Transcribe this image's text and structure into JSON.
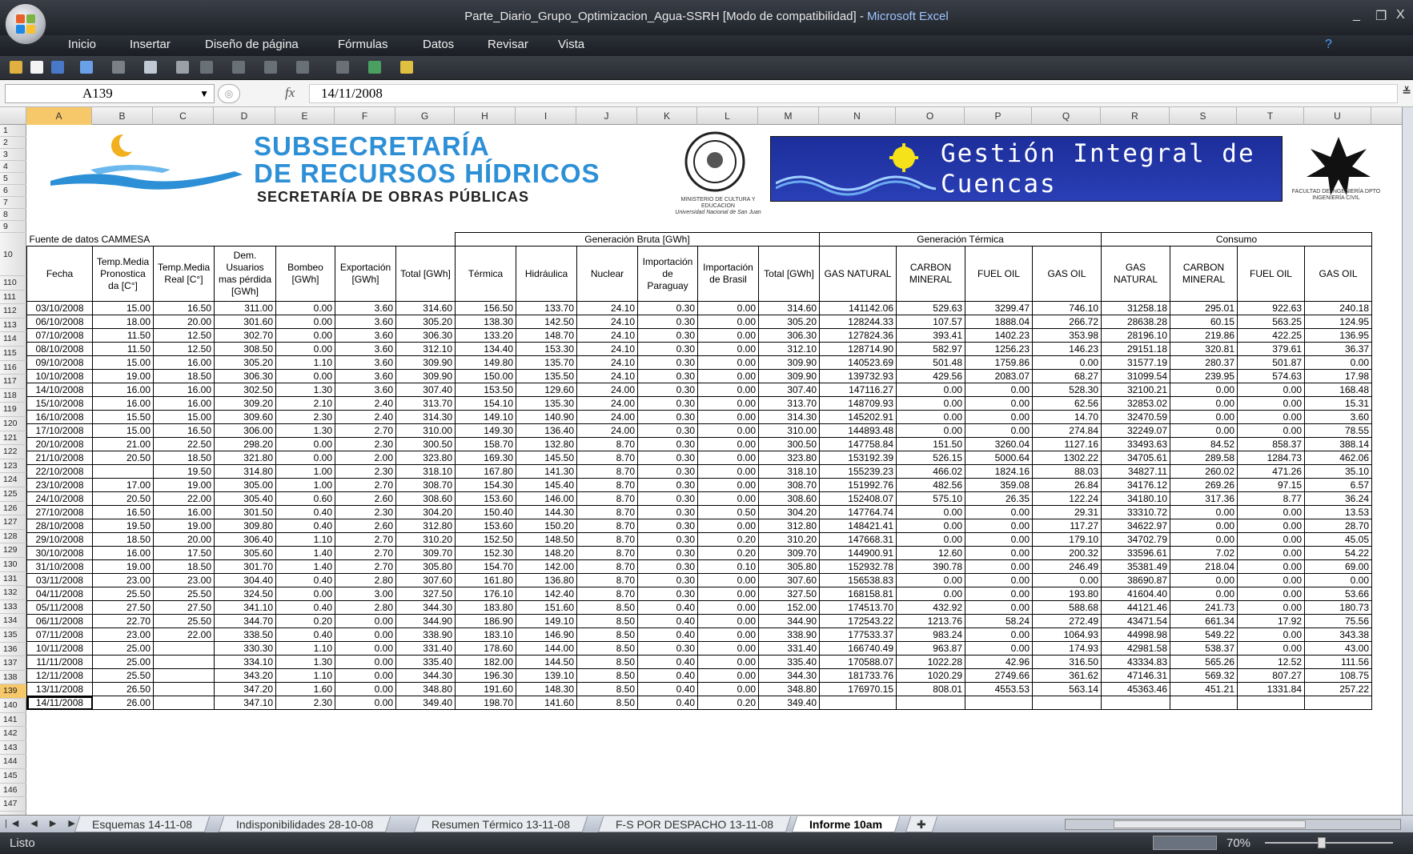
{
  "window": {
    "title": "Parte_Diario_Grupo_Optimizacion_Agua-SSRH  [Modo de compatibilidad]",
    "app": "Microsoft Excel",
    "controls": [
      "_",
      "❐",
      "X"
    ]
  },
  "ribbon": {
    "tabs": [
      "Inicio",
      "Insertar",
      "Diseño de página",
      "Fórmulas",
      "Datos",
      "Revisar",
      "Vista"
    ]
  },
  "formula_bar": {
    "name_box": "A139",
    "fx": "fx",
    "value": "14/11/2008"
  },
  "columns": [
    "A",
    "B",
    "C",
    "D",
    "E",
    "F",
    "G",
    "H",
    "I",
    "J",
    "K",
    "L",
    "M",
    "N",
    "O",
    "P",
    "Q",
    "R",
    "S",
    "T",
    "U"
  ],
  "row_headers": [
    "1",
    "2",
    "3",
    "4",
    "5",
    "6",
    "7",
    "8",
    "9",
    "10",
    "110",
    "111",
    "112",
    "113",
    "114",
    "115",
    "116",
    "117",
    "118",
    "119",
    "120",
    "121",
    "122",
    "123",
    "124",
    "125",
    "126",
    "127",
    "128",
    "129",
    "130",
    "131",
    "132",
    "133",
    "134",
    "135",
    "136",
    "137",
    "138",
    "139",
    "140",
    "141",
    "142",
    "143",
    "144",
    "145",
    "146",
    "147",
    "148"
  ],
  "banner": {
    "subsec_1": "SUBSECRETARÍA",
    "subsec_2": "DE RECURSOS HÍDRICOS",
    "secretaria": "SECRETARÍA DE OBRAS PÚBLICAS",
    "ministerio": "MINISTERIO DE CULTURA Y EDUCACION",
    "universidad": "Universidad Nacional de San Juan",
    "gih_1": "Gestión Integral de",
    "gih_2": "Cuencas Hidrográficas",
    "facultad": "FACULTAD DE INGENIERÍA DPTO INGENIERÍA CIVIL"
  },
  "table": {
    "source": "Fuente de datos CAMMESA",
    "groups": {
      "gen_bruta": "Generación Bruta [GWh]",
      "gen_termica": "Generación Térmica",
      "consumo": "Consumo"
    },
    "headers": [
      "Fecha",
      "Temp.Media Pronostica da [C°]",
      "Temp.Media Real [C°]",
      "Dem. Usuarios mas pérdida [GWh]",
      "Bombeo [GWh]",
      "Exportación [GWh]",
      "Total [GWh]",
      "Térmica",
      "Hidráulica",
      "Nuclear",
      "Importación de Paraguay",
      "Importación de Brasil",
      "Total [GWh]",
      "GAS NATURAL",
      "CARBON MINERAL",
      "FUEL OIL",
      "GAS OIL",
      "GAS NATURAL",
      "CARBON MINERAL",
      "FUEL OIL",
      "GAS OIL"
    ],
    "rows": [
      [
        "03/10/2008",
        "15.00",
        "16.50",
        "311.00",
        "0.00",
        "3.60",
        "314.60",
        "156.50",
        "133.70",
        "24.10",
        "0.30",
        "0.00",
        "314.60",
        "141142.06",
        "529.63",
        "3299.47",
        "746.10",
        "31258.18",
        "295.01",
        "922.63",
        "240.18"
      ],
      [
        "06/10/2008",
        "18.00",
        "20.00",
        "301.60",
        "0.00",
        "3.60",
        "305.20",
        "138.30",
        "142.50",
        "24.10",
        "0.30",
        "0.00",
        "305.20",
        "128244.33",
        "107.57",
        "1888.04",
        "266.72",
        "28638.28",
        "60.15",
        "563.25",
        "124.95"
      ],
      [
        "07/10/2008",
        "11.50",
        "12.50",
        "302.70",
        "0.00",
        "3.60",
        "306.30",
        "133.20",
        "148.70",
        "24.10",
        "0.30",
        "0.00",
        "306.30",
        "127824.36",
        "393.41",
        "1402.23",
        "353.98",
        "28196.10",
        "219.86",
        "422.25",
        "136.95"
      ],
      [
        "08/10/2008",
        "11.50",
        "12.50",
        "308.50",
        "0.00",
        "3.60",
        "312.10",
        "134.40",
        "153.30",
        "24.10",
        "0.30",
        "0.00",
        "312.10",
        "128714.90",
        "582.97",
        "1256.23",
        "146.23",
        "29151.18",
        "320.81",
        "379.61",
        "36.37"
      ],
      [
        "09/10/2008",
        "15.00",
        "16.00",
        "305.20",
        "1.10",
        "3.60",
        "309.90",
        "149.80",
        "135.70",
        "24.10",
        "0.30",
        "0.00",
        "309.90",
        "140523.69",
        "501.48",
        "1759.86",
        "0.00",
        "31577.19",
        "280.37",
        "501.87",
        "0.00"
      ],
      [
        "10/10/2008",
        "19.00",
        "18.50",
        "306.30",
        "0.00",
        "3.60",
        "309.90",
        "150.00",
        "135.50",
        "24.10",
        "0.30",
        "0.00",
        "309.90",
        "139732.93",
        "429.56",
        "2083.07",
        "68.27",
        "31099.54",
        "239.95",
        "574.63",
        "17.98"
      ],
      [
        "14/10/2008",
        "16.00",
        "16.00",
        "302.50",
        "1.30",
        "3.60",
        "307.40",
        "153.50",
        "129.60",
        "24.00",
        "0.30",
        "0.00",
        "307.40",
        "147116.27",
        "0.00",
        "0.00",
        "528.30",
        "32100.21",
        "0.00",
        "0.00",
        "168.48"
      ],
      [
        "15/10/2008",
        "16.00",
        "16.00",
        "309.20",
        "2.10",
        "2.40",
        "313.70",
        "154.10",
        "135.30",
        "24.00",
        "0.30",
        "0.00",
        "313.70",
        "148709.93",
        "0.00",
        "0.00",
        "62.56",
        "32853.02",
        "0.00",
        "0.00",
        "15.31"
      ],
      [
        "16/10/2008",
        "15.50",
        "15.00",
        "309.60",
        "2.30",
        "2.40",
        "314.30",
        "149.10",
        "140.90",
        "24.00",
        "0.30",
        "0.00",
        "314.30",
        "145202.91",
        "0.00",
        "0.00",
        "14.70",
        "32470.59",
        "0.00",
        "0.00",
        "3.60"
      ],
      [
        "17/10/2008",
        "15.00",
        "16.50",
        "306.00",
        "1.30",
        "2.70",
        "310.00",
        "149.30",
        "136.40",
        "24.00",
        "0.30",
        "0.00",
        "310.00",
        "144893.48",
        "0.00",
        "0.00",
        "274.84",
        "32249.07",
        "0.00",
        "0.00",
        "78.55"
      ],
      [
        "20/10/2008",
        "21.00",
        "22.50",
        "298.20",
        "0.00",
        "2.30",
        "300.50",
        "158.70",
        "132.80",
        "8.70",
        "0.30",
        "0.00",
        "300.50",
        "147758.84",
        "151.50",
        "3260.04",
        "1127.16",
        "33493.63",
        "84.52",
        "858.37",
        "388.14"
      ],
      [
        "21/10/2008",
        "20.50",
        "18.50",
        "321.80",
        "0.00",
        "2.00",
        "323.80",
        "169.30",
        "145.50",
        "8.70",
        "0.30",
        "0.00",
        "323.80",
        "153192.39",
        "526.15",
        "5000.64",
        "1302.22",
        "34705.61",
        "289.58",
        "1284.73",
        "462.06"
      ],
      [
        "22/10/2008",
        "",
        "19.50",
        "314.80",
        "1.00",
        "2.30",
        "318.10",
        "167.80",
        "141.30",
        "8.70",
        "0.30",
        "0.00",
        "318.10",
        "155239.23",
        "466.02",
        "1824.16",
        "88.03",
        "34827.11",
        "260.02",
        "471.26",
        "35.10"
      ],
      [
        "23/10/2008",
        "17.00",
        "19.00",
        "305.00",
        "1.00",
        "2.70",
        "308.70",
        "154.30",
        "145.40",
        "8.70",
        "0.30",
        "0.00",
        "308.70",
        "151992.76",
        "482.56",
        "359.08",
        "26.84",
        "34176.12",
        "269.26",
        "97.15",
        "6.57"
      ],
      [
        "24/10/2008",
        "20.50",
        "22.00",
        "305.40",
        "0.60",
        "2.60",
        "308.60",
        "153.60",
        "146.00",
        "8.70",
        "0.30",
        "0.00",
        "308.60",
        "152408.07",
        "575.10",
        "26.35",
        "122.24",
        "34180.10",
        "317.36",
        "8.77",
        "36.24"
      ],
      [
        "27/10/2008",
        "16.50",
        "16.00",
        "301.50",
        "0.40",
        "2.30",
        "304.20",
        "150.40",
        "144.30",
        "8.70",
        "0.30",
        "0.50",
        "304.20",
        "147764.74",
        "0.00",
        "0.00",
        "29.31",
        "33310.72",
        "0.00",
        "0.00",
        "13.53"
      ],
      [
        "28/10/2008",
        "19.50",
        "19.00",
        "309.80",
        "0.40",
        "2.60",
        "312.80",
        "153.60",
        "150.20",
        "8.70",
        "0.30",
        "0.00",
        "312.80",
        "148421.41",
        "0.00",
        "0.00",
        "117.27",
        "34622.97",
        "0.00",
        "0.00",
        "28.70"
      ],
      [
        "29/10/2008",
        "18.50",
        "20.00",
        "306.40",
        "1.10",
        "2.70",
        "310.20",
        "152.50",
        "148.50",
        "8.70",
        "0.30",
        "0.20",
        "310.20",
        "147668.31",
        "0.00",
        "0.00",
        "179.10",
        "34702.79",
        "0.00",
        "0.00",
        "45.05"
      ],
      [
        "30/10/2008",
        "16.00",
        "17.50",
        "305.60",
        "1.40",
        "2.70",
        "309.70",
        "152.30",
        "148.20",
        "8.70",
        "0.30",
        "0.20",
        "309.70",
        "144900.91",
        "12.60",
        "0.00",
        "200.32",
        "33596.61",
        "7.02",
        "0.00",
        "54.22"
      ],
      [
        "31/10/2008",
        "19.00",
        "18.50",
        "301.70",
        "1.40",
        "2.70",
        "305.80",
        "154.70",
        "142.00",
        "8.70",
        "0.30",
        "0.10",
        "305.80",
        "152932.78",
        "390.78",
        "0.00",
        "246.49",
        "35381.49",
        "218.04",
        "0.00",
        "69.00"
      ],
      [
        "03/11/2008",
        "23.00",
        "23.00",
        "304.40",
        "0.40",
        "2.80",
        "307.60",
        "161.80",
        "136.80",
        "8.70",
        "0.30",
        "0.00",
        "307.60",
        "156538.83",
        "0.00",
        "0.00",
        "0.00",
        "38690.87",
        "0.00",
        "0.00",
        "0.00"
      ],
      [
        "04/11/2008",
        "25.50",
        "25.50",
        "324.50",
        "0.00",
        "3.00",
        "327.50",
        "176.10",
        "142.40",
        "8.70",
        "0.30",
        "0.00",
        "327.50",
        "168158.81",
        "0.00",
        "0.00",
        "193.80",
        "41604.40",
        "0.00",
        "0.00",
        "53.66"
      ],
      [
        "05/11/2008",
        "27.50",
        "27.50",
        "341.10",
        "0.40",
        "2.80",
        "344.30",
        "183.80",
        "151.60",
        "8.50",
        "0.40",
        "0.00",
        "152.00",
        "174513.70",
        "432.92",
        "0.00",
        "588.68",
        "44121.46",
        "241.73",
        "0.00",
        "180.73"
      ],
      [
        "06/11/2008",
        "22.70",
        "25.50",
        "344.70",
        "0.20",
        "0.00",
        "344.90",
        "186.90",
        "149.10",
        "8.50",
        "0.40",
        "0.00",
        "344.90",
        "172543.22",
        "1213.76",
        "58.24",
        "272.49",
        "43471.54",
        "661.34",
        "17.92",
        "75.56"
      ],
      [
        "07/11/2008",
        "23.00",
        "22.00",
        "338.50",
        "0.40",
        "0.00",
        "338.90",
        "183.10",
        "146.90",
        "8.50",
        "0.40",
        "0.00",
        "338.90",
        "177533.37",
        "983.24",
        "0.00",
        "1064.93",
        "44998.98",
        "549.22",
        "0.00",
        "343.38"
      ],
      [
        "10/11/2008",
        "25.00",
        "",
        "330.30",
        "1.10",
        "0.00",
        "331.40",
        "178.60",
        "144.00",
        "8.50",
        "0.30",
        "0.00",
        "331.40",
        "166740.49",
        "963.87",
        "0.00",
        "174.93",
        "42981.58",
        "538.37",
        "0.00",
        "43.00"
      ],
      [
        "11/11/2008",
        "25.00",
        "",
        "334.10",
        "1.30",
        "0.00",
        "335.40",
        "182.00",
        "144.50",
        "8.50",
        "0.40",
        "0.00",
        "335.40",
        "170588.07",
        "1022.28",
        "42.96",
        "316.50",
        "43334.83",
        "565.26",
        "12.52",
        "111.56"
      ],
      [
        "12/11/2008",
        "25.50",
        "",
        "343.20",
        "1.10",
        "0.00",
        "344.30",
        "196.30",
        "139.10",
        "8.50",
        "0.40",
        "0.00",
        "344.30",
        "181733.76",
        "1020.29",
        "2749.66",
        "361.62",
        "47146.31",
        "569.32",
        "807.27",
        "108.75"
      ],
      [
        "13/11/2008",
        "26.50",
        "",
        "347.20",
        "1.60",
        "0.00",
        "348.80",
        "191.60",
        "148.30",
        "8.50",
        "0.40",
        "0.00",
        "348.80",
        "176970.15",
        "808.01",
        "4553.53",
        "563.14",
        "45363.46",
        "451.21",
        "1331.84",
        "257.22"
      ],
      [
        "14/11/2008",
        "26.00",
        "",
        "347.10",
        "2.30",
        "0.00",
        "349.40",
        "198.70",
        "141.60",
        "8.50",
        "0.40",
        "0.20",
        "349.40",
        "",
        "",
        "",
        "",
        "",
        "",
        "",
        ""
      ]
    ]
  },
  "sheet_tabs": [
    "Esquemas 14-11-08",
    "Indisponibilidades 28-10-08",
    "Resumen Térmico 13-11-08",
    "F-S POR DESPACHO 13-11-08",
    "Informe 10am"
  ],
  "status": {
    "text": "Listo",
    "zoom": "70%"
  }
}
